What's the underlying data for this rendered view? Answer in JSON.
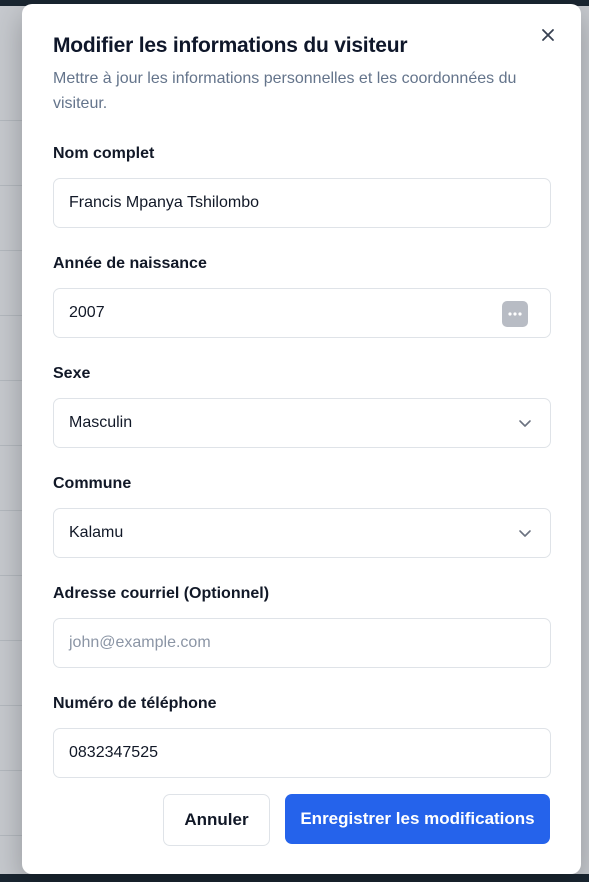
{
  "modal": {
    "title": "Modifier les informations du visiteur",
    "subtitle": "Mettre à jour les informations personnelles et les coordonnées du visiteur."
  },
  "form": {
    "full_name": {
      "label": "Nom complet",
      "value": "Francis Mpanya Tshilombo"
    },
    "birth_year": {
      "label": "Année de naissance",
      "value": "2007"
    },
    "sex": {
      "label": "Sexe",
      "value": "Masculin"
    },
    "commune": {
      "label": "Commune",
      "value": "Kalamu"
    },
    "email": {
      "label": "Adresse courriel (Optionnel)",
      "placeholder": "john@example.com",
      "value": ""
    },
    "phone": {
      "label": "Numéro de téléphone",
      "value": "0832347525"
    }
  },
  "actions": {
    "cancel_label": "Annuler",
    "save_label": "Enregistrer les modifications"
  },
  "colors": {
    "primary": "#2563eb",
    "muted_text": "#64748b",
    "border": "#dfe3e8"
  },
  "icons": {
    "close": "close-icon",
    "select": "chevron-down-icon",
    "picker": "more-dots-icon"
  }
}
